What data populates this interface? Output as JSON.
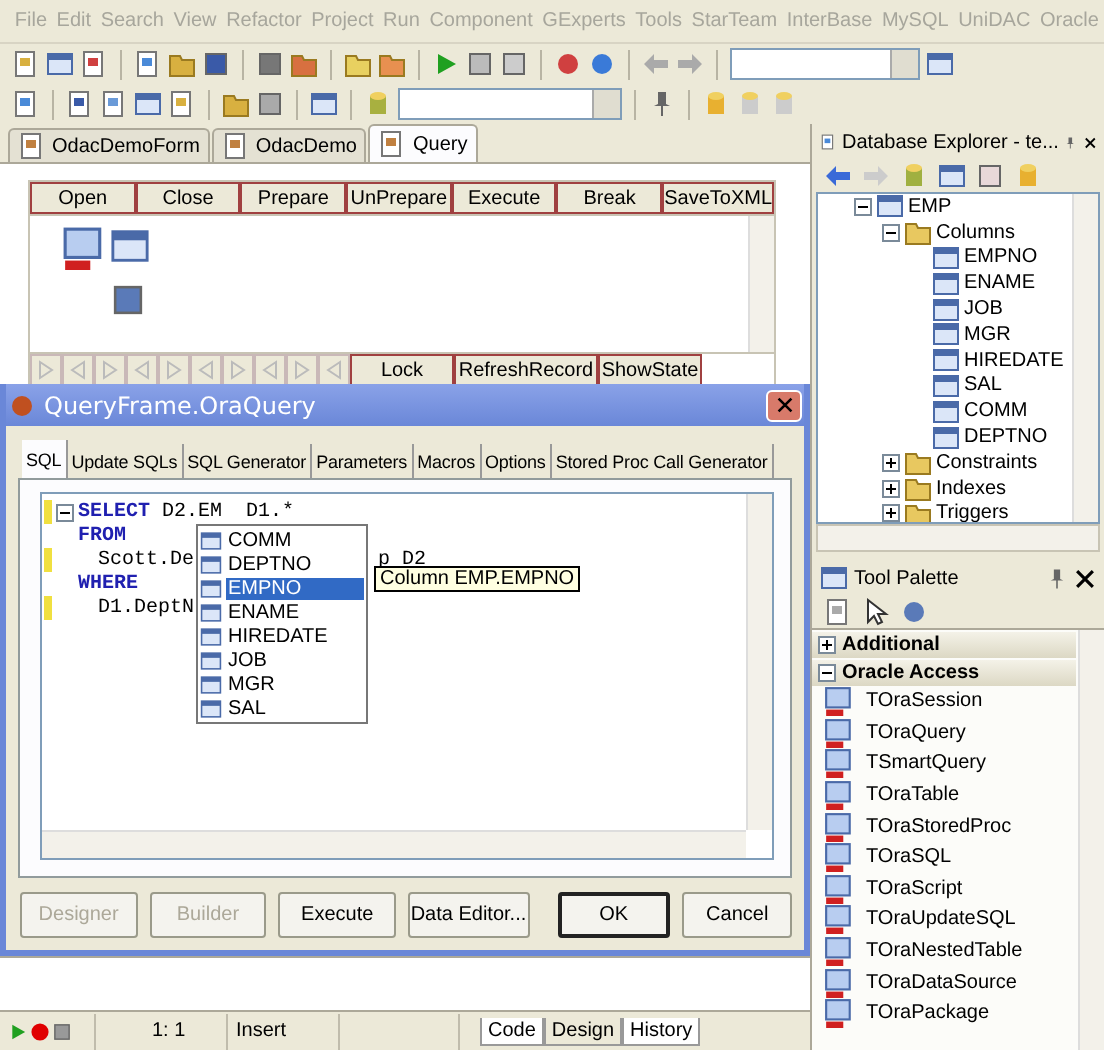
{
  "menu": [
    "File",
    "Edit",
    "Search",
    "View",
    "Refactor",
    "Project",
    "Run",
    "Component",
    "GExperts",
    "Tools",
    "StarTeam",
    "InterBase",
    "MySQL",
    "UniDAC",
    "Oracle"
  ],
  "doc_tabs": [
    {
      "label": "OdacDemoForm",
      "selected": false
    },
    {
      "label": "OdacDemo",
      "selected": false
    },
    {
      "label": "Query",
      "selected": true
    }
  ],
  "form": {
    "buttons": [
      "Open",
      "Close",
      "Prepare",
      "UnPrepare",
      "Execute",
      "Break",
      "SaveToXML"
    ],
    "navigator_buttons": [
      "Lock",
      "RefreshRecord",
      "ShowState"
    ]
  },
  "db_explorer": {
    "title": "Database Explorer - te...",
    "tree": [
      {
        "label": "EMP",
        "kind": "table",
        "expanded": true,
        "children": [
          {
            "label": "Columns",
            "kind": "folder",
            "expanded": true,
            "children": [
              {
                "label": "EMPNO",
                "kind": "column"
              },
              {
                "label": "ENAME",
                "kind": "column"
              },
              {
                "label": "JOB",
                "kind": "column"
              },
              {
                "label": "MGR",
                "kind": "column"
              },
              {
                "label": "HIREDATE",
                "kind": "column"
              },
              {
                "label": "SAL",
                "kind": "column"
              },
              {
                "label": "COMM",
                "kind": "column"
              },
              {
                "label": "DEPTNO",
                "kind": "column"
              }
            ]
          },
          {
            "label": "Constraints",
            "kind": "folder",
            "expanded": false
          },
          {
            "label": "Indexes",
            "kind": "folder",
            "expanded": false
          },
          {
            "label": "Triggers",
            "kind": "folder",
            "expanded": false
          }
        ]
      }
    ]
  },
  "tool_palette": {
    "title": "Tool Palette",
    "categories": [
      {
        "label": "Additional",
        "expanded": false
      },
      {
        "label": "Oracle Access",
        "expanded": true
      }
    ],
    "items": [
      "TOraSession",
      "TOraQuery",
      "TSmartQuery",
      "TOraTable",
      "TOraStoredProc",
      "TOraSQL",
      "TOraScript",
      "TOraUpdateSQL",
      "TOraNestedTable",
      "TOraDataSource",
      "TOraPackage"
    ]
  },
  "dialog": {
    "title": "QueryFrame.OraQuery",
    "tabs": [
      {
        "label": "SQL",
        "selected": true
      },
      {
        "label": "Update SQLs",
        "selected": false
      },
      {
        "label": "SQL Generator",
        "selected": false
      },
      {
        "label": "Parameters",
        "selected": false
      },
      {
        "label": "Macros",
        "selected": false
      },
      {
        "label": "Options",
        "selected": false
      },
      {
        "label": "Stored Proc Call Generator",
        "selected": false
      }
    ],
    "code": [
      {
        "keyword": "SELECT",
        "text": "D2.EM",
        "after": "D1.*",
        "marked": true
      },
      {
        "keyword": "FROM",
        "marked": false
      },
      {
        "text": "Scott.De",
        "after": "p D2",
        "marked": true
      },
      {
        "keyword": "WHERE",
        "marked": false
      },
      {
        "text": "D1.DeptN",
        "marked": true
      }
    ],
    "completion": [
      {
        "label": "COMM",
        "selected": false
      },
      {
        "label": "DEPTNO",
        "selected": false
      },
      {
        "label": "EMPNO",
        "selected": true
      },
      {
        "label": "ENAME",
        "selected": false
      },
      {
        "label": "HIREDATE",
        "selected": false
      },
      {
        "label": "JOB",
        "selected": false
      },
      {
        "label": "MGR",
        "selected": false
      },
      {
        "label": "SAL",
        "selected": false
      }
    ],
    "hint": "Column EMP.EMPNO",
    "buttons": [
      {
        "label": "Designer",
        "disabled": true
      },
      {
        "label": "Builder",
        "disabled": true
      },
      {
        "label": "Execute",
        "disabled": false
      },
      {
        "label": "Data Editor...",
        "disabled": false
      },
      {
        "label": "OK",
        "disabled": false
      },
      {
        "label": "Cancel",
        "disabled": false
      }
    ]
  },
  "status_bar": {
    "position": "1:  1",
    "mode": "Insert",
    "tabs": [
      {
        "label": "Code",
        "selected": false
      },
      {
        "label": "Design",
        "selected": true
      },
      {
        "label": "History",
        "selected": false
      }
    ]
  }
}
